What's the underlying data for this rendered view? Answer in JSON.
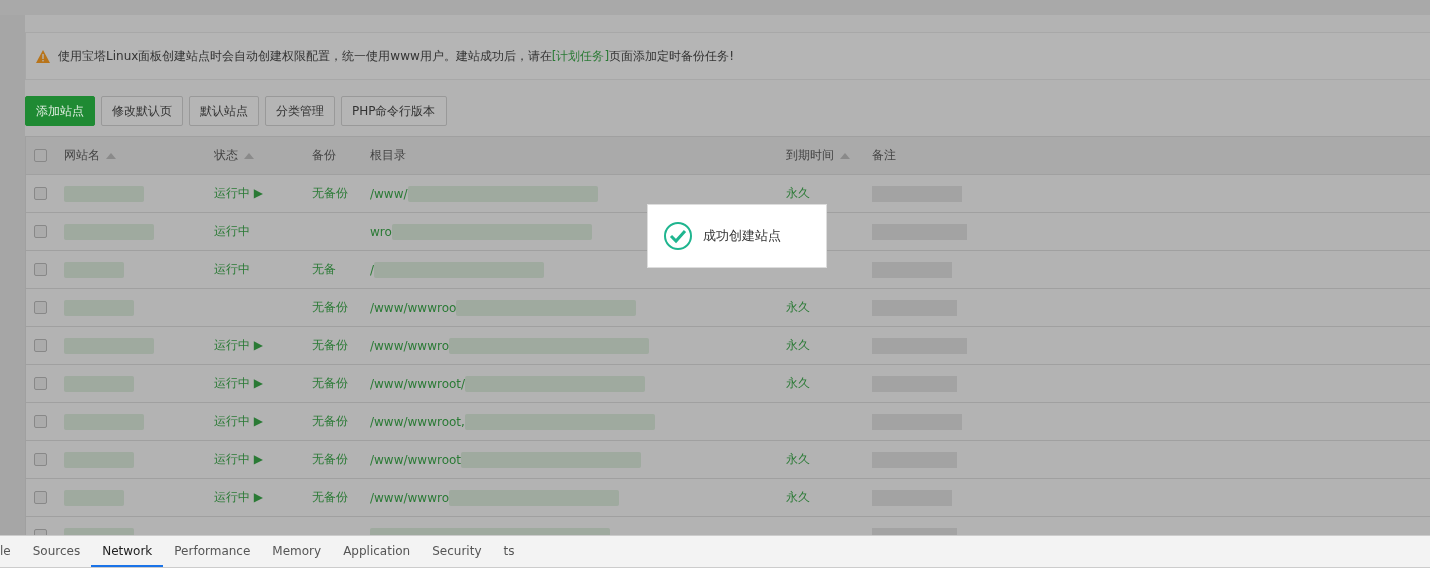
{
  "notice": {
    "text": "使用宝塔Linux面板创建站点时会自动创建权限配置，统一使用www用户。建站成功后，请在",
    "link": "[计划任务]",
    "tail": "页面添加定时备份任务!"
  },
  "toolbar": [
    {
      "label": "添加站点",
      "kind": "primary"
    },
    {
      "label": "修改默认页",
      "kind": "default"
    },
    {
      "label": "默认站点",
      "kind": "default"
    },
    {
      "label": "分类管理",
      "kind": "default"
    },
    {
      "label": "PHP命令行版本",
      "kind": "default"
    }
  ],
  "table": {
    "select_all": {
      "checked": false
    },
    "columns": [
      {
        "label": "网站名",
        "sortable": true
      },
      {
        "label": "状态",
        "sortable": true
      },
      {
        "label": "备份",
        "sortable": false
      },
      {
        "label": "根目录",
        "sortable": false
      },
      {
        "label": "到期时间",
        "sortable": true
      },
      {
        "label": "备注",
        "sortable": false
      }
    ],
    "rows": [
      {
        "checked": false,
        "status": "运行中 ▶",
        "backup": "无备份",
        "root": "/www/",
        "expiry": "永久"
      },
      {
        "checked": false,
        "status": "运行中",
        "root": "wro"
      },
      {
        "checked": false,
        "status": "运行中",
        "backup": "无备",
        "root": "/"
      },
      {
        "checked": false,
        "backup": "无备份",
        "root": "/www/wwwroo",
        "expiry": "永久"
      },
      {
        "checked": false,
        "status": "运行中 ▶",
        "backup": "无备份",
        "root": "/www/wwwro",
        "expiry": "永久"
      },
      {
        "checked": false,
        "status": "运行中 ▶",
        "backup": "无备份",
        "root": "/www/wwwroot/",
        "expiry": "永久"
      },
      {
        "checked": false,
        "status": "运行中 ▶",
        "backup": "无备份",
        "root": "/www/wwwroot,"
      },
      {
        "checked": false,
        "status": "运行中 ▶",
        "backup": "无备份",
        "root": "/www/wwwroot",
        "expiry": "永久"
      },
      {
        "checked": false,
        "status": "运行中 ▶",
        "backup": "无备份",
        "root": "/www/wwwro",
        "expiry": "永久"
      },
      {
        "checked": false
      }
    ]
  },
  "toast": {
    "text": "成功创建站点"
  },
  "devtools_tabs": [
    {
      "label": "le",
      "selected": false
    },
    {
      "label": "Sources",
      "selected": false
    },
    {
      "label": "Network",
      "selected": true
    },
    {
      "label": "Performance",
      "selected": false
    },
    {
      "label": "Memory",
      "selected": false
    },
    {
      "label": "Application",
      "selected": false
    },
    {
      "label": "Security",
      "selected": false
    },
    {
      "label": "ts",
      "selected": false
    }
  ]
}
